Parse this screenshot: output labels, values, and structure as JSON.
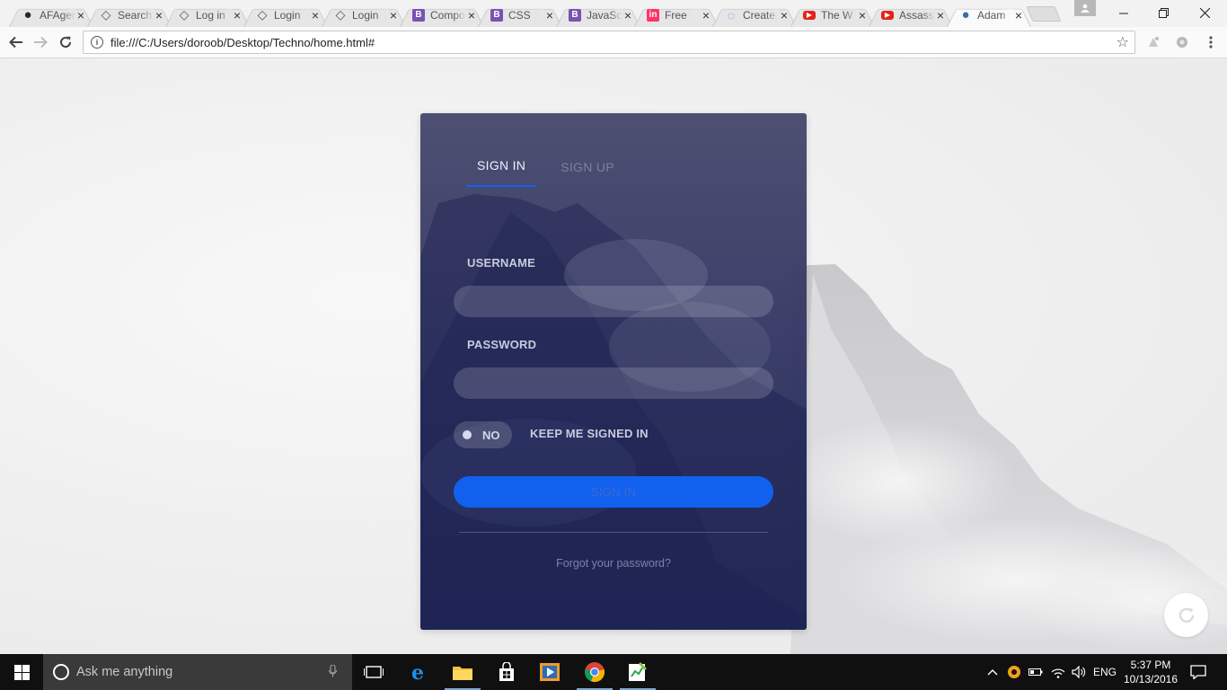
{
  "browser": {
    "tabs": [
      {
        "title": "AFAgency",
        "icon": "github-icon"
      },
      {
        "title": "Search",
        "icon": "codepen-icon"
      },
      {
        "title": "Log in",
        "icon": "codepen-icon"
      },
      {
        "title": "Login",
        "icon": "codepen-icon"
      },
      {
        "title": "Login",
        "icon": "codepen-icon"
      },
      {
        "title": "Components",
        "icon": "bootstrap-icon"
      },
      {
        "title": "CSS",
        "icon": "bootstrap-icon"
      },
      {
        "title": "JavaScript",
        "icon": "bootstrap-icon"
      },
      {
        "title": "Free",
        "icon": "invision-icon"
      },
      {
        "title": "Create",
        "icon": "loading-icon"
      },
      {
        "title": "The W",
        "icon": "youtube-icon"
      },
      {
        "title": "Assassin",
        "icon": "youtube-icon"
      },
      {
        "title": "Adam",
        "icon": "globe-icon",
        "active": true
      }
    ],
    "address": "file:///C:/Users/doroob/Desktop/Techno/home.html#"
  },
  "login": {
    "tab_signin": "SIGN IN",
    "tab_signup": "SIGN UP",
    "username_label": "USERNAME",
    "password_label": "PASSWORD",
    "toggle_state": "NO",
    "keep_signed_in": "KEEP ME SIGNED IN",
    "submit_label": "SIGN IN",
    "forgot": "Forgot your password?"
  },
  "taskbar": {
    "search_placeholder": "Ask me anything",
    "language": "ENG",
    "time": "5:37 PM",
    "date": "10/13/2016"
  },
  "colors": {
    "accent": "#1161ee",
    "card_top": "#484a6e",
    "card_bottom": "#222858",
    "taskbar": "#101010"
  }
}
